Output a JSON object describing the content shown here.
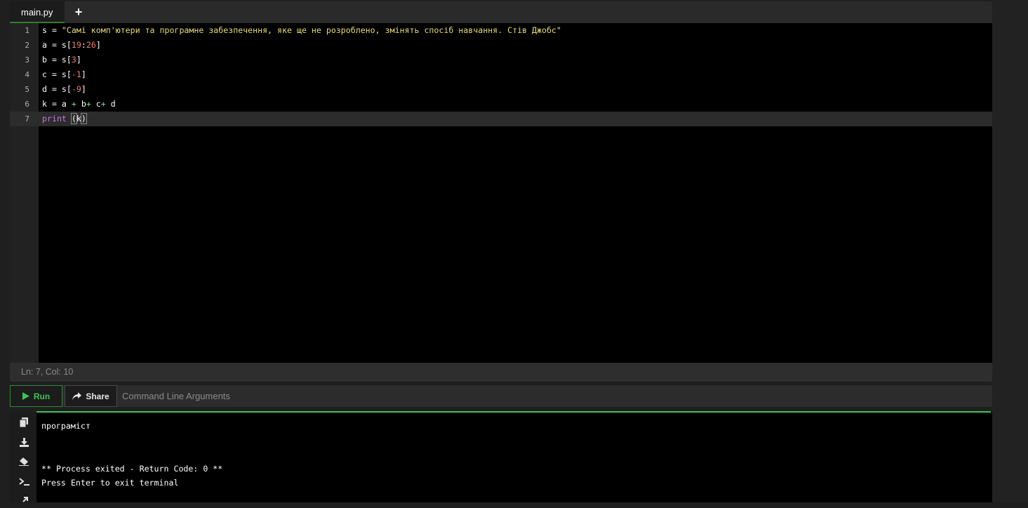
{
  "tabs": [
    {
      "label": "main.py",
      "active": true
    }
  ],
  "add_tab_label": "+",
  "editor": {
    "lines": [
      {
        "num": "1",
        "tokens": [
          [
            "t",
            "s = "
          ],
          [
            "str",
            "\"Самі комп'ютери та програмне забезпечення, яке ще не розроблено, змінять спосіб навчання. Стів Джобс\""
          ]
        ]
      },
      {
        "num": "2",
        "tokens": [
          [
            "t",
            "a = s["
          ],
          [
            "num",
            "19"
          ],
          [
            "t",
            ":"
          ],
          [
            "num",
            "26"
          ],
          [
            "t",
            "]"
          ]
        ]
      },
      {
        "num": "3",
        "tokens": [
          [
            "t",
            "b = s["
          ],
          [
            "num",
            "3"
          ],
          [
            "t",
            "]"
          ]
        ]
      },
      {
        "num": "4",
        "tokens": [
          [
            "t",
            "c = s["
          ],
          [
            "num",
            "-1"
          ],
          [
            "t",
            "]"
          ]
        ]
      },
      {
        "num": "5",
        "tokens": [
          [
            "t",
            "d = s["
          ],
          [
            "num",
            "-9"
          ],
          [
            "t",
            "]"
          ]
        ]
      },
      {
        "num": "6",
        "tokens": [
          [
            "t",
            "k = a "
          ],
          [
            "plus",
            "+"
          ],
          [
            "t",
            " b"
          ],
          [
            "plus",
            "+"
          ],
          [
            "t",
            " c"
          ],
          [
            "plus",
            "+"
          ],
          [
            "t",
            " d"
          ]
        ]
      },
      {
        "num": "7",
        "tokens": [
          [
            "kw",
            "print"
          ],
          [
            "t",
            " "
          ],
          [
            "br",
            "("
          ],
          [
            "t",
            "k"
          ],
          [
            "br",
            ")"
          ]
        ],
        "current": true
      }
    ]
  },
  "status": {
    "text": "Ln: 7,  Col: 10"
  },
  "toolbar": {
    "run_label": "Run",
    "share_label": "Share",
    "args_placeholder": "Command Line Arguments"
  },
  "terminal": {
    "icons": [
      "copy-icon",
      "download-icon",
      "eraser-icon",
      "terminal-icon",
      "expand-icon"
    ],
    "lines": [
      "програміст",
      "",
      "",
      "** Process exited - Return Code: 0 **",
      "Press Enter to exit terminal"
    ]
  },
  "colors": {
    "accent_green": "#3ec257",
    "string": "#e6db74",
    "number": "#f07d6b",
    "keyword": "#c678dd"
  }
}
